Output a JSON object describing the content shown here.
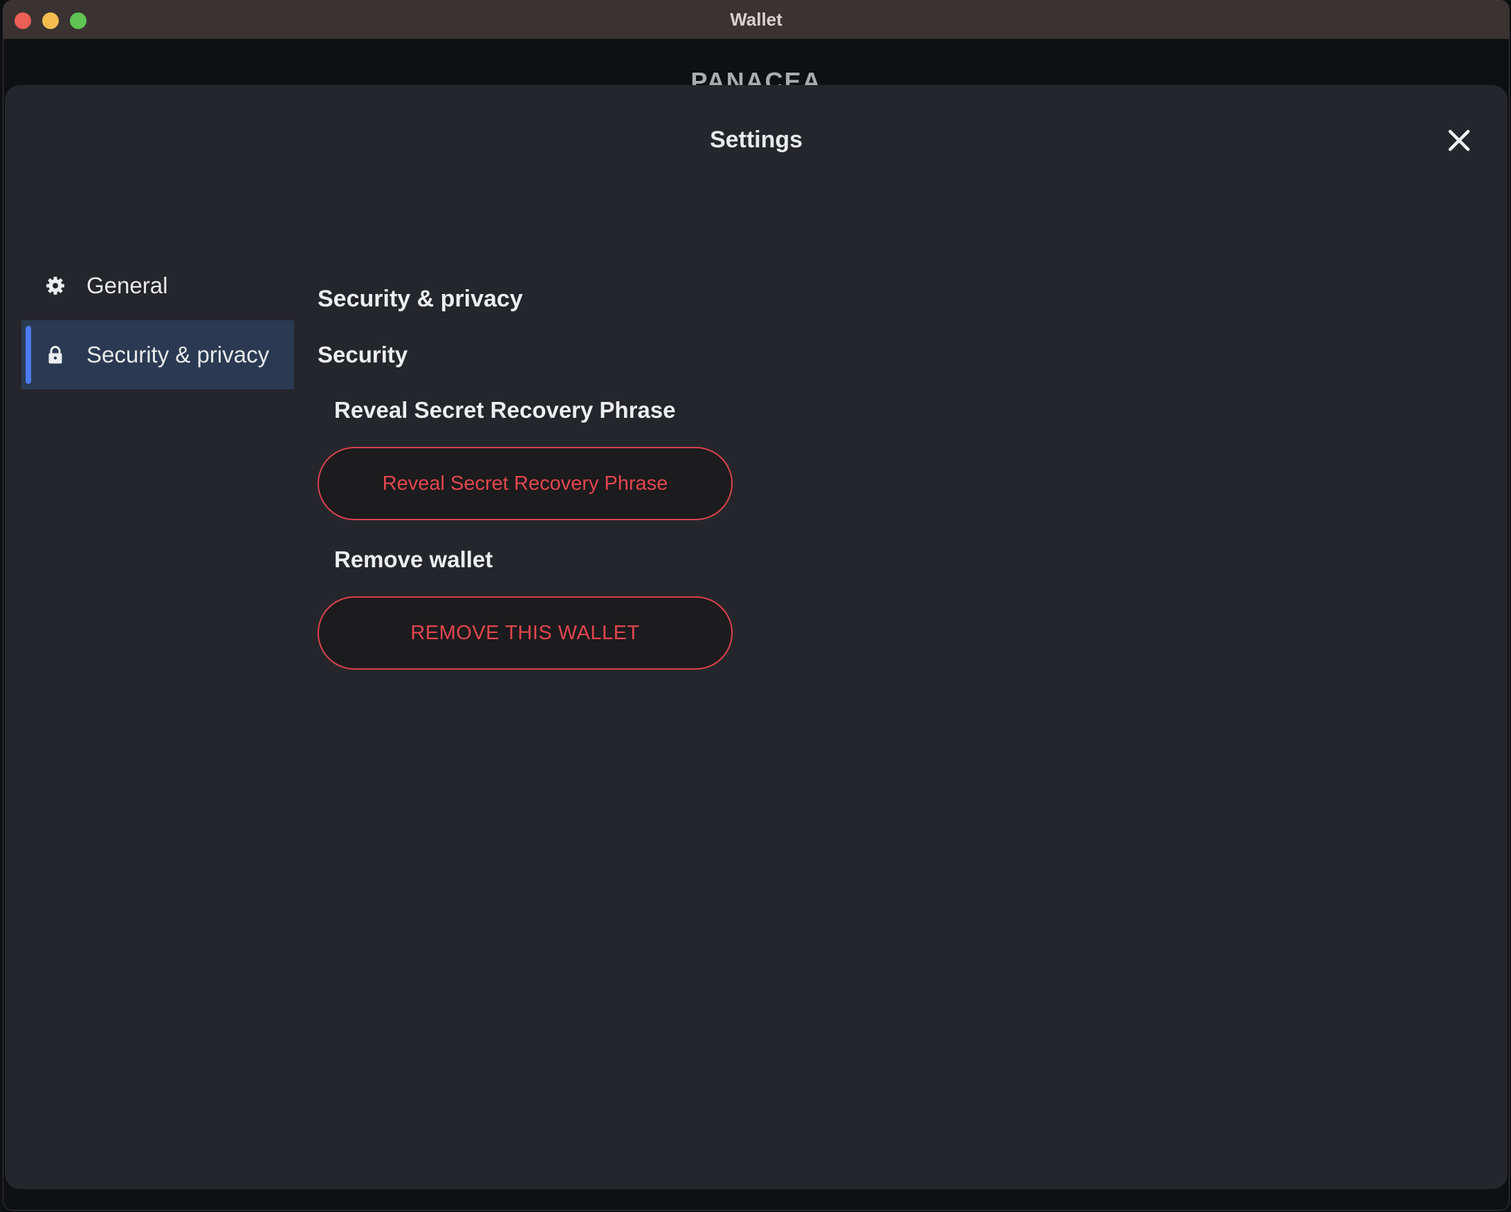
{
  "window": {
    "title": "Wallet"
  },
  "app": {
    "brand": "PANACEA"
  },
  "settings": {
    "title": "Settings",
    "close_icon": "close-icon",
    "sidebar": {
      "items": [
        {
          "label": "General",
          "icon": "gear-icon",
          "active": false
        },
        {
          "label": "Security & privacy",
          "icon": "lock-icon",
          "active": true
        }
      ]
    },
    "content": {
      "page_heading": "Security & privacy",
      "section_heading": "Security",
      "reveal_heading": "Reveal Secret Recovery Phrase",
      "reveal_button": "Reveal Secret Recovery Phrase",
      "remove_heading": "Remove wallet",
      "remove_button": "REMOVE THIS WALLET"
    }
  },
  "colors": {
    "accent": "#4a7bf0",
    "danger": "#e2464f",
    "modal_bg": "#25262b",
    "active_item_bg": "#2b3a52"
  }
}
